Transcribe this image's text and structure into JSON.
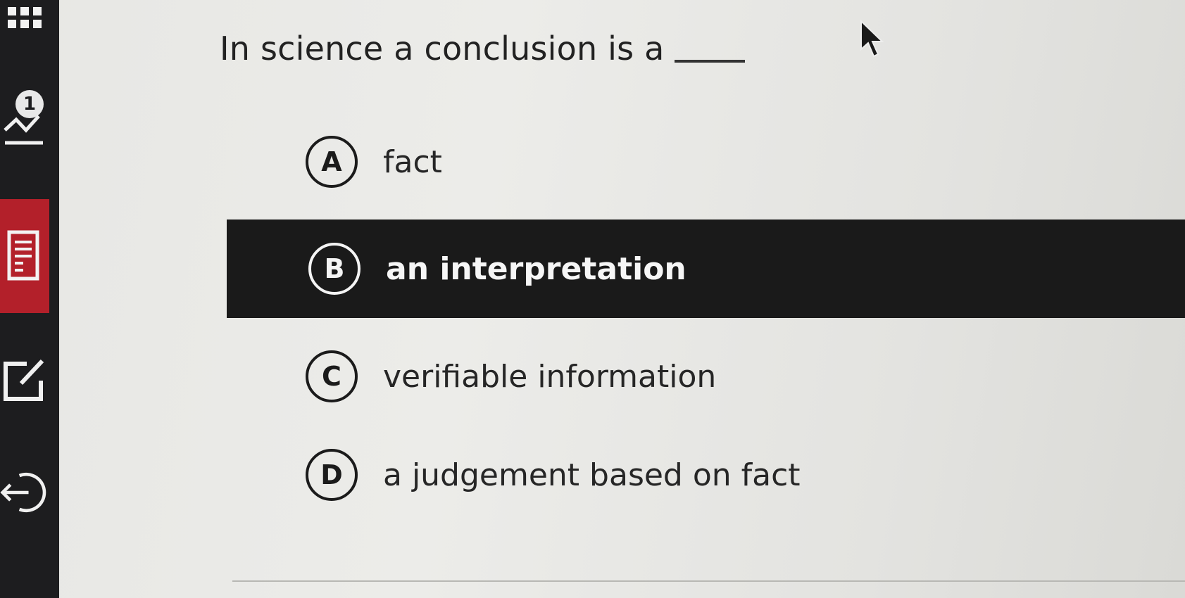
{
  "sidebar": {
    "notification_count": "1",
    "icons": [
      "grid-menu-icon",
      "notifications-icon",
      "notes-icon",
      "edit-icon",
      "exit-icon"
    ],
    "active_color": "#b3202a"
  },
  "question": {
    "text": "In science a conclusion is a"
  },
  "options": [
    {
      "letter": "A",
      "text": "fact",
      "selected": false
    },
    {
      "letter": "B",
      "text": "an interpretation",
      "selected": true
    },
    {
      "letter": "C",
      "text": "verifiable information",
      "selected": false
    },
    {
      "letter": "D",
      "text": "a judgement based on fact",
      "selected": false
    }
  ],
  "colors": {
    "selected_background": "#1a1a1a",
    "selected_text": "#f6f6f6"
  }
}
